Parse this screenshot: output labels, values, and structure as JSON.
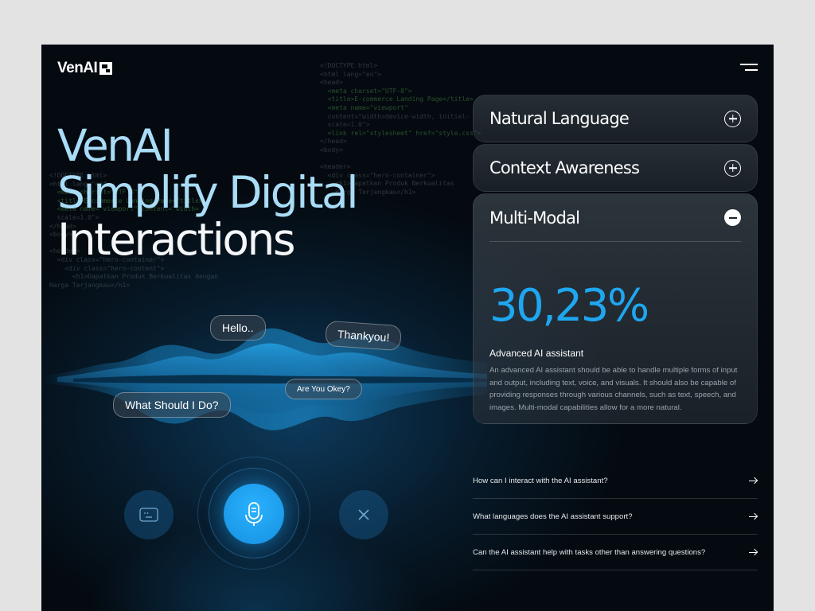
{
  "brand": {
    "name": "VenAI"
  },
  "hero": {
    "line1": "VenAI",
    "line2": "Simplify Digital",
    "line3": "Interactions"
  },
  "bubbles": {
    "hello": "Hello..",
    "thankyou": "Thankyou!",
    "are_you_okey": "Are You Okey?",
    "what_should": "What Should I Do?"
  },
  "accordion": {
    "items": [
      {
        "title": "Natural Language"
      },
      {
        "title": "Context Awareness"
      }
    ],
    "open": {
      "title": "Multi-Modal",
      "stat": "30,23%",
      "label": "Advanced AI assistant",
      "description": "An advanced AI assistant should be able to handle multiple forms of input and output, including text, voice, and visuals. It should also be capable of providing responses through various channels, such as text, speech, and images. Multi-modal capabilities allow for a more natural."
    }
  },
  "faq": [
    {
      "question": "How can I interact with the AI assistant?"
    },
    {
      "question": "What languages does the AI assistant support?"
    },
    {
      "question": "Can the AI assistant help with tasks other than answering questions?"
    }
  ],
  "code_lines": {
    "block1": [
      "<!DOCTYPE html>",
      "<html lang=\"en\">",
      "<head>",
      "  <meta charset=\"UTF-8\">",
      "  <title>E-commerce Landing Page</title>",
      "  <meta name=\"viewport\"",
      "  content=\"width=device-width, initial-",
      "  scale=1.0\">",
      "  <link rel=\"stylesheet\" href=\"style.css\">",
      "</head>",
      "<body>",
      "",
      "<header>",
      "  <div class=\"hero-container\">",
      "    <h1>Dapatkan Produk Berkualitas",
      "    Harga Terjangkau</h1>"
    ],
    "block2": [
      "<!DOCTYPE html>",
      "<html lang=\"en\">",
      "  <meta charset=\"UTF-8\">",
      "  <title>E-commerce Landing Page</title>",
      "  <meta name=\"viewport\" content=\"width=",
      "  scale=1.0\">",
      "</head>",
      "<body>",
      "",
      "<header>",
      "  <div class=\"hero-container\">",
      "    <div class=\"hero-content\">",
      "      <h1>Dapatkan Produk Berkualitas dengan",
      "Harga Terjangkau</h1>"
    ]
  },
  "colors": {
    "accent": "#1ea7f0",
    "hero_light": "#a9dcf6",
    "background": "#04080c"
  },
  "icons": {
    "keyboard": "keyboard-icon",
    "mic": "microphone-icon",
    "close": "close-icon",
    "plus": "plus-circle-icon",
    "minus": "minus-circle-icon",
    "arrow": "arrow-right-icon",
    "menu": "menu-icon"
  }
}
